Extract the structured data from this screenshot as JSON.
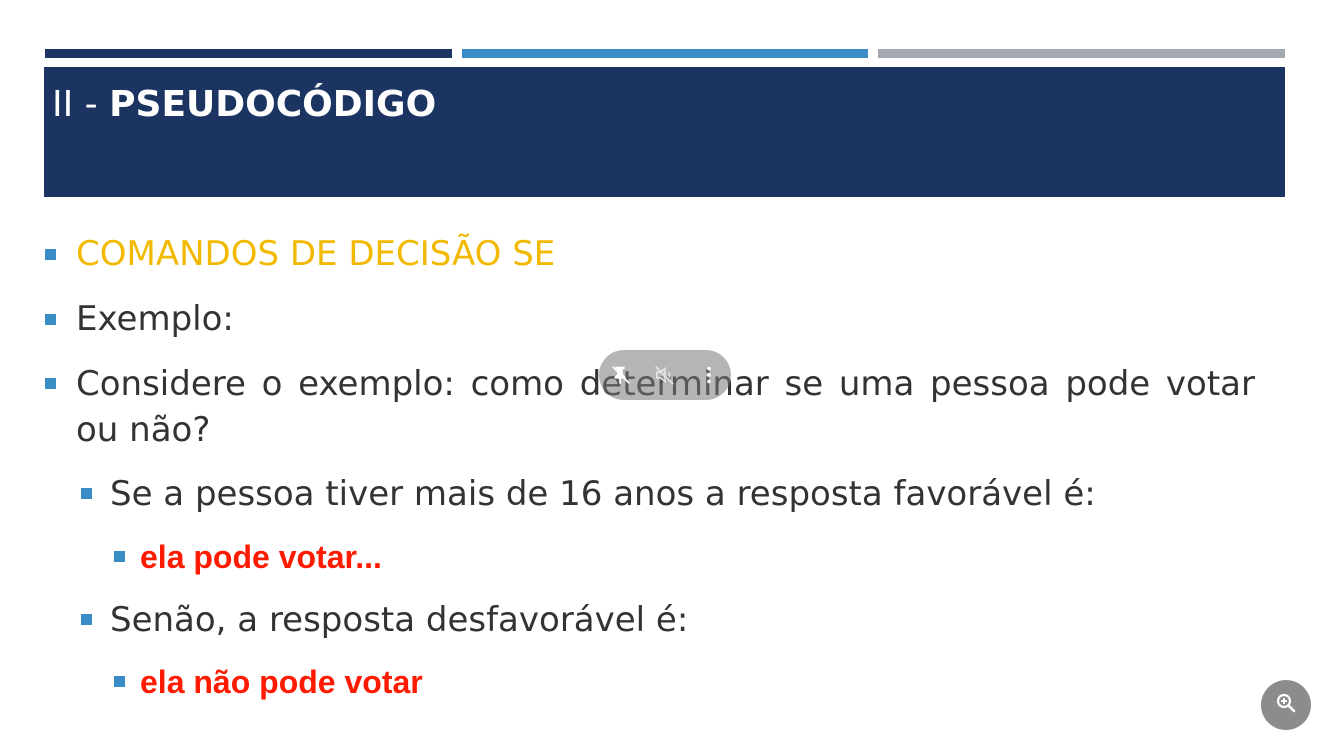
{
  "slide": {
    "title_prefix": "II - ",
    "title_main": "PSEUDOCÓDIGO",
    "bullets": [
      {
        "text": "COMANDOS DE DECISÃO SE"
      },
      {
        "text": "Exemplo:"
      },
      {
        "text": "Considere o exemplo: como determinar se uma pessoa pode votar ou não?"
      },
      {
        "text": "Se a pessoa tiver mais de 16 anos a resposta favorável é:"
      },
      {
        "text": "ela pode votar..."
      },
      {
        "text": "Senão, a resposta desfavorável é:"
      },
      {
        "text": "ela não pode votar"
      }
    ]
  },
  "colors": {
    "title_bg": "#1b3461",
    "bullet": "#3a8cc4",
    "heading": "#f2b900",
    "emphasis": "#ff1a00",
    "body_text": "#333333"
  },
  "video_controls": {
    "icons": [
      "pin-off-icon",
      "volume-mute-icon",
      "more-vert-icon"
    ]
  },
  "zoom_button": {
    "icon": "zoom-in-icon"
  }
}
